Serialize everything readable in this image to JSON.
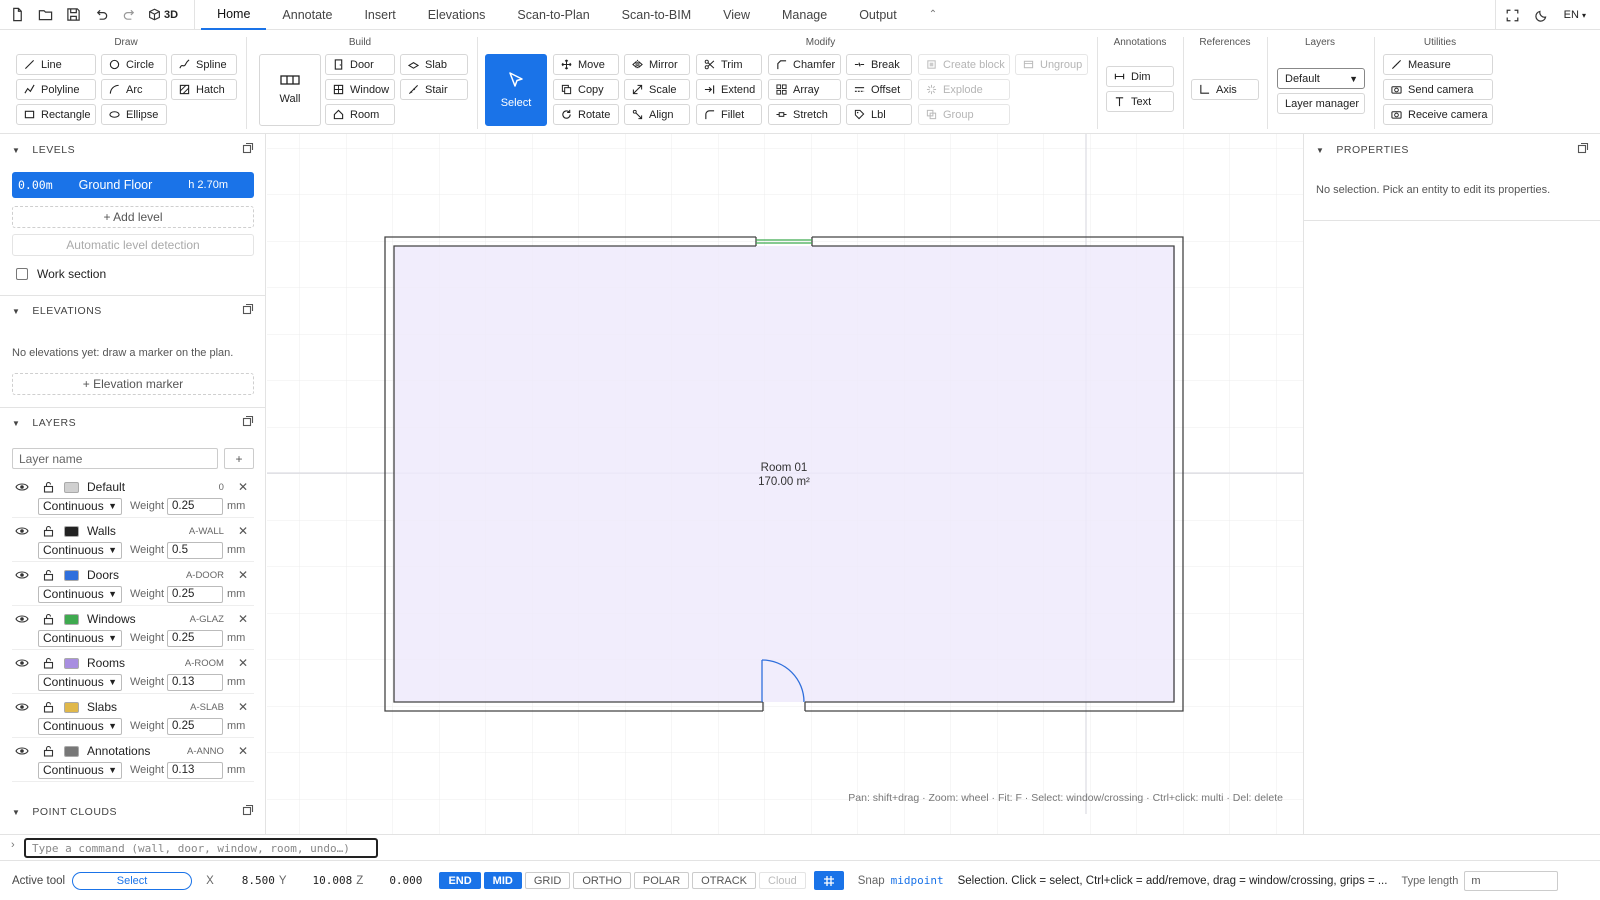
{
  "topbar": {
    "view3d_label": "3D",
    "tabs": [
      "Home",
      "Annotate",
      "Insert",
      "Elevations",
      "Scan-to-Plan",
      "Scan-to-BIM",
      "View",
      "Manage",
      "Output"
    ],
    "active_tab": "Home",
    "language": "EN"
  },
  "ribbon": {
    "draw": {
      "title": "Draw",
      "buttons": [
        "Line",
        "Circle",
        "Spline",
        "Polyline",
        "Arc",
        "Hatch",
        "Rectangle",
        "Ellipse"
      ]
    },
    "build": {
      "title": "Build",
      "wall": "Wall",
      "buttons": [
        "Door",
        "Slab",
        "Window",
        "Stair",
        "Room"
      ]
    },
    "select": "Select",
    "modify": {
      "title": "Modify",
      "buttons": [
        "Move",
        "Mirror",
        "Trim",
        "Chamfer",
        "Break",
        "Create block",
        "Ungroup",
        "Copy",
        "Scale",
        "Extend",
        "Array",
        "Offset",
        "Explode",
        "Rotate",
        "Align",
        "Fillet",
        "Stretch",
        "Lbl",
        "Group"
      ]
    },
    "annotations": {
      "title": "Annotations",
      "buttons": [
        "Dim",
        "Text"
      ]
    },
    "references": {
      "title": "References",
      "buttons": [
        "Axis"
      ]
    },
    "layers": {
      "title": "Layers",
      "current": "Default",
      "manager": "Layer manager"
    },
    "utilities": {
      "title": "Utilities",
      "buttons": [
        "Measure",
        "Send camera",
        "Receive camera"
      ]
    }
  },
  "levels": {
    "title": "LEVELS",
    "items": [
      {
        "elevation": "0.00m",
        "name": "Ground Floor",
        "height": "h 2.70m"
      }
    ],
    "add_label": "+ Add level",
    "auto_label": "Automatic level detection",
    "work_section": "Work section"
  },
  "elevations": {
    "title": "ELEVATIONS",
    "empty": "No elevations yet: draw a marker on the plan.",
    "add_label": "+ Elevation marker"
  },
  "layers_panel": {
    "title": "LAYERS",
    "name_placeholder": "Layer name",
    "add": "+",
    "weight_label": "Weight",
    "unit": "mm",
    "items": [
      {
        "name": "Default",
        "code": "0",
        "linetype": "Continuous",
        "weight": "0.25",
        "color": "#d0d0d0"
      },
      {
        "name": "Walls",
        "code": "A-WALL",
        "linetype": "Continuous",
        "weight": "0.5",
        "color": "#222222"
      },
      {
        "name": "Doors",
        "code": "A-DOOR",
        "linetype": "Continuous",
        "weight": "0.25",
        "color": "#2f6fdc"
      },
      {
        "name": "Windows",
        "code": "A-GLAZ",
        "linetype": "Continuous",
        "weight": "0.25",
        "color": "#3faa4f"
      },
      {
        "name": "Rooms",
        "code": "A-ROOM",
        "linetype": "Continuous",
        "weight": "0.13",
        "color": "#a88ee0"
      },
      {
        "name": "Slabs",
        "code": "A-SLAB",
        "linetype": "Continuous",
        "weight": "0.25",
        "color": "#e0b84a"
      },
      {
        "name": "Annotations",
        "code": "A-ANNO",
        "linetype": "Continuous",
        "weight": "0.13",
        "color": "#777777"
      }
    ]
  },
  "point_clouds": {
    "title": "POINT CLOUDS"
  },
  "canvas": {
    "room_name": "Room 01",
    "room_area": "170.00 m²",
    "hint": "Pan: shift+drag · Zoom: wheel · Fit: F · Select: window/crossing · Ctrl+click: multi · Del: delete"
  },
  "properties": {
    "title": "PROPERTIES",
    "empty": "No selection. Pick an entity to edit its properties."
  },
  "command": {
    "prompt": "›",
    "placeholder": "Type a command (wall, door, window, room, undo…)"
  },
  "status": {
    "active_tool_label": "Active tool",
    "active_tool": "Select",
    "x_label": "X",
    "x": "8.500",
    "y_label": "Y",
    "y": "10.008",
    "z_label": "Z",
    "z": "0.000",
    "toggles": [
      {
        "label": "END",
        "on": true
      },
      {
        "label": "MID",
        "on": true
      },
      {
        "label": "GRID",
        "on": false
      },
      {
        "label": "ORTHO",
        "on": false
      },
      {
        "label": "POLAR",
        "on": false
      },
      {
        "label": "OTRACK",
        "on": false
      },
      {
        "label": "Cloud",
        "on": false
      }
    ],
    "snap_label": "Snap",
    "snap_mode": "midpoint",
    "message": "Selection. Click = select, Ctrl+click = add/remove, drag = window/crossing, grips = ...",
    "type_length_label": "Type length",
    "type_length_value": "m"
  },
  "colors": {
    "accent": "#1a73e8",
    "room_fill": "#eeeafb",
    "window": "#3faa4f",
    "door": "#2f6fdc"
  }
}
